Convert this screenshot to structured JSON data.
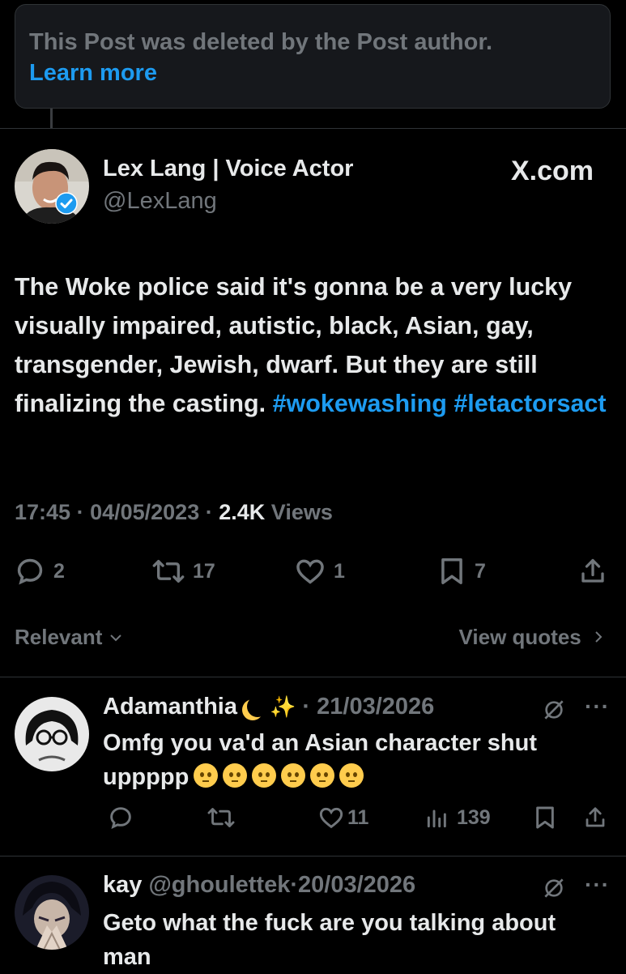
{
  "deleted_notice": {
    "text": "This Post was deleted by the Post author.",
    "link": "Learn more"
  },
  "post": {
    "author_name": "Lex Lang | Voice Actor",
    "handle": "@LexLang",
    "brand": "X.com",
    "text_main": "The Woke police said it's gonna be a very lucky visually impaired, autistic, black, Asian, gay, transgender, Jewish, dwarf. But they are still finalizing the casting.",
    "hashtag1": "#wokewashing",
    "hashtag2": "#letactorsact",
    "time": "17:45",
    "date": "04/05/2023",
    "views_count": "2.4K",
    "views_label": "Views",
    "replies": "2",
    "reposts": "17",
    "likes": "1",
    "bookmarks": "7"
  },
  "sort": {
    "label": "Relevant",
    "view_quotes": "View quotes"
  },
  "replies": [
    {
      "name": "Adamanthia",
      "handle": "",
      "date": "21/03/2026",
      "text": "Omfg you va'd an Asian character shut uppppp",
      "likes": "11",
      "views": "139"
    },
    {
      "name": "kay",
      "handle": "@ghoulettek",
      "date": "20/03/2026",
      "text": "Geto what the fuck are you talking about man"
    }
  ],
  "colors": {
    "background": "#000000",
    "text": "#e7e9ea",
    "muted": "#71767b",
    "accent": "#1d9bf0",
    "notice_bg": "#16181c"
  },
  "icons": [
    "reply-icon",
    "repost-icon",
    "like-icon",
    "bookmark-icon",
    "share-icon",
    "views-icon",
    "grok-icon",
    "more-icon",
    "verified-icon",
    "chevron-down-icon",
    "chevron-right-icon"
  ]
}
